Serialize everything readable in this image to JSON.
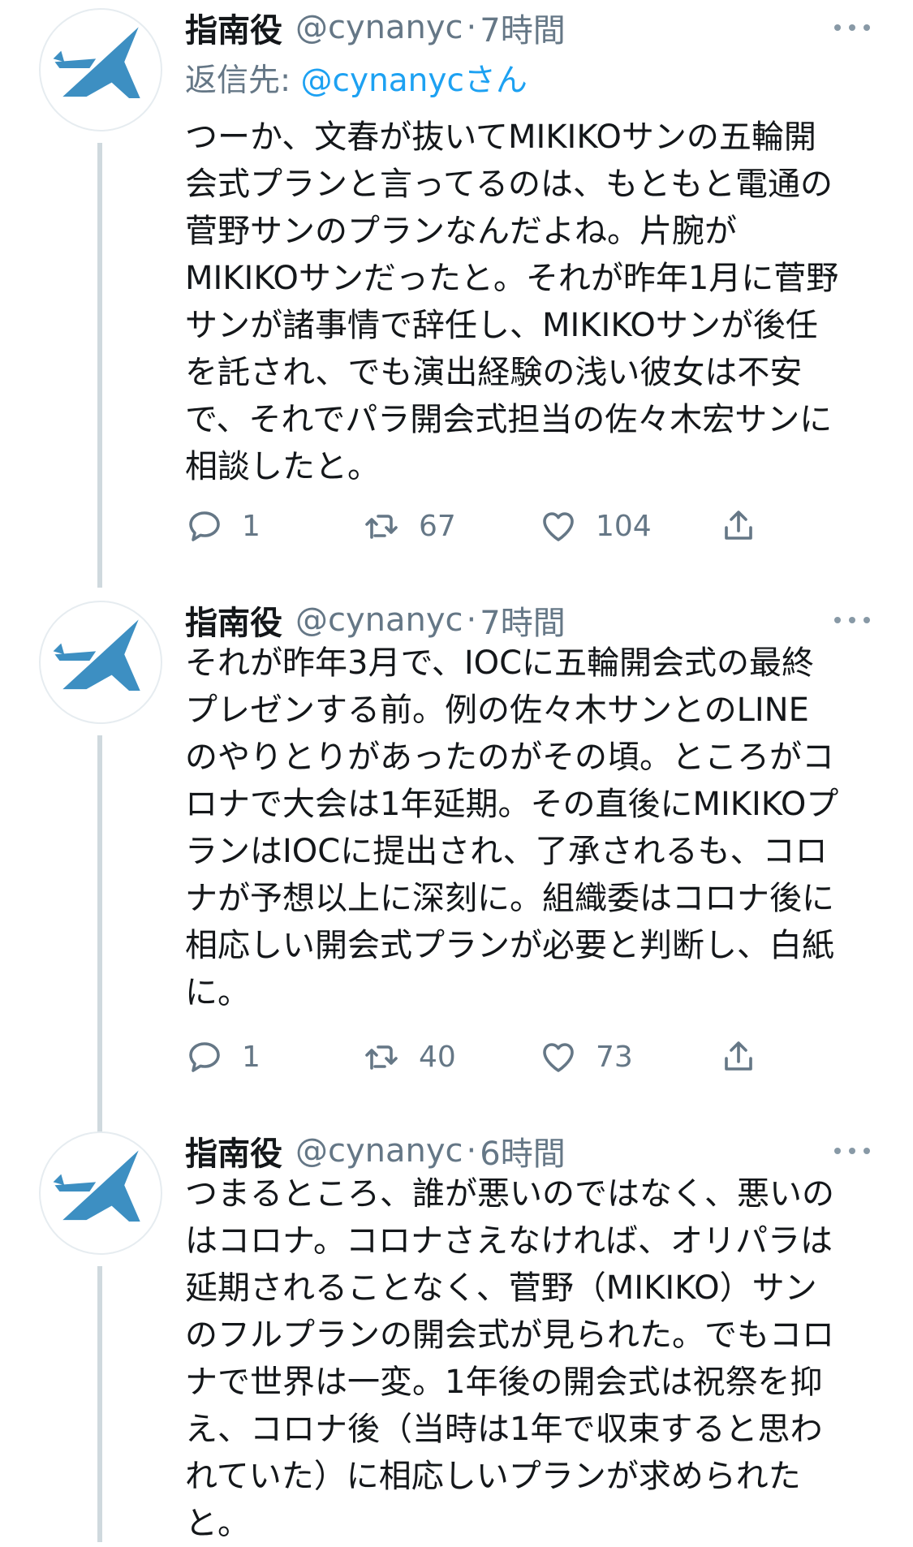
{
  "tweets": [
    {
      "name": "指南役",
      "handle": "@cynanyc",
      "separator": "·",
      "time": "7時間",
      "reply_to_label": "返信先: ",
      "reply_to_mention": "@cynanycさん",
      "lines": [
        "つーか、文春が抜いてMIKIKOサンの五輪開",
        "会式プランと言ってるのは、もともと電通の",
        "菅野サンのプランなんだよね。片腕が",
        "MIKIKOサンだったと。それが昨年1月に菅野",
        "サンが諸事情で辞任し、MIKIKOサンが後任",
        "を託され、でも演出経験の浅い彼女は不安",
        "で、それでパラ開会式担当の佐々木宏サンに",
        "相談したと。"
      ],
      "replies": "1",
      "retweets": "67",
      "likes": "104"
    },
    {
      "name": "指南役",
      "handle": "@cynanyc",
      "separator": "·",
      "time": "7時間",
      "lines": [
        "それが昨年3月で、IOCに五輪開会式の最終",
        "プレゼンする前。例の佐々木サンとのLINE",
        "のやりとりがあったのがその頃。ところがコ",
        "ロナで大会は1年延期。その直後にMIKIKOプ",
        "ランはIOCに提出され、了承されるも、コロ",
        "ナが予想以上に深刻に。組織委はコロナ後に",
        "相応しい開会式プランが必要と判断し、白紙",
        "に。"
      ],
      "replies": "1",
      "retweets": "40",
      "likes": "73"
    },
    {
      "name": "指南役",
      "handle": "@cynanyc",
      "separator": "·",
      "time": "6時間",
      "lines": [
        "つまるところ、誰が悪いのではなく、悪いの",
        "はコロナ。コロナさえなければ、オリパラは",
        "延期されることなく、菅野（MIKIKO）サン",
        "のフルプランの開会式が見られた。でもコロ",
        "ナで世界は一変。1年後の開会式は祝祭を抑",
        "え、コロナ後（当時は1年で収束すると思わ",
        "れていた）に相応しいプランが求められた",
        "と。"
      ]
    }
  ],
  "icons": {
    "avatar": "paper-plane-logo-icon",
    "more": "more-dots-icon",
    "reply": "reply-bubble-icon",
    "retweet": "retweet-icon",
    "like": "heart-icon",
    "share": "share-icon"
  },
  "colors": {
    "text": "#14171a",
    "secondary": "#657786",
    "link": "#1da1f2",
    "thread_line": "#cfd9de",
    "avatar_blue": "#3d8fc2"
  }
}
